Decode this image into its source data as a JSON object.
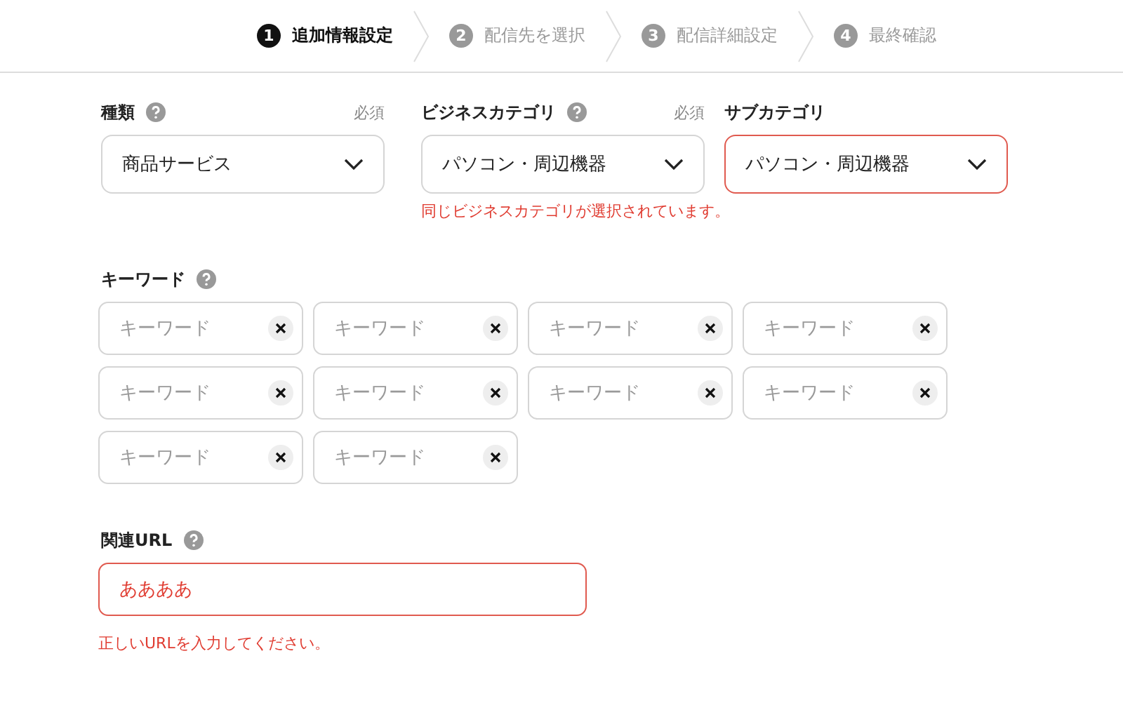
{
  "steps": [
    {
      "number": "1",
      "label": "追加情報設定",
      "selected": true
    },
    {
      "number": "2",
      "label": "配信先を選択",
      "selected": false
    },
    {
      "number": "3",
      "label": "配信詳細設定",
      "selected": false
    },
    {
      "number": "4",
      "label": "最終確認",
      "selected": false
    }
  ],
  "selects": [
    {
      "label": "種類",
      "help": true,
      "required": "必須",
      "value": "商品サービス",
      "invalid": false
    },
    {
      "label": "ビジネスカテゴリ",
      "help": true,
      "required": "必須",
      "value": "パソコン・周辺機器",
      "invalid": false,
      "error": "同じビジネスカテゴリが選択されています。"
    },
    {
      "label": "サブカテゴリ",
      "help": false,
      "value": "パソコン・周辺機器",
      "invalid": true
    }
  ],
  "keywords": {
    "label": "キーワード",
    "help": true,
    "fields": [
      {
        "placeholder": "キーワード"
      },
      {
        "placeholder": "キーワード"
      },
      {
        "placeholder": "キーワード"
      },
      {
        "placeholder": "キーワード"
      },
      {
        "placeholder": "キーワード"
      },
      {
        "placeholder": "キーワード"
      },
      {
        "placeholder": "キーワード"
      },
      {
        "placeholder": "キーワード"
      },
      {
        "placeholder": "キーワード"
      },
      {
        "placeholder": "キーワード"
      }
    ]
  },
  "url": {
    "label": "関連URL",
    "help": true,
    "value": "ああああ",
    "invalid": true,
    "error": "正しいURLを入力してください。"
  }
}
